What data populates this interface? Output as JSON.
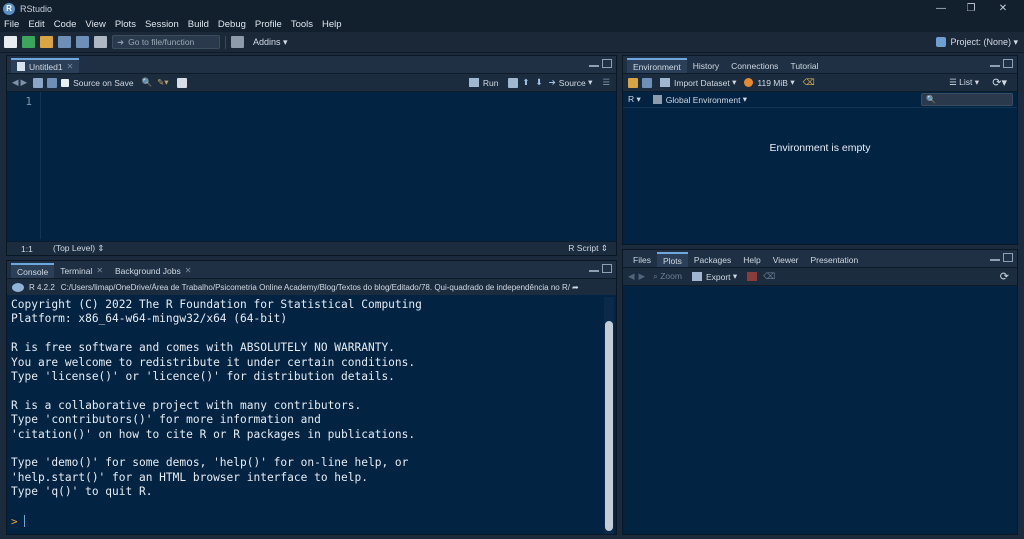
{
  "window": {
    "title": "RStudio"
  },
  "menu": [
    "File",
    "Edit",
    "Code",
    "View",
    "Plots",
    "Session",
    "Build",
    "Debug",
    "Profile",
    "Tools",
    "Help"
  ],
  "toolbar": {
    "goto_placeholder": "Go to file/function",
    "addins_label": "Addins",
    "project_label": "Project: (None)"
  },
  "source": {
    "tab_label": "Untitled1",
    "source_on_save": "Source on Save",
    "run_label": "Run",
    "source_label": "Source",
    "line_number": "1",
    "status_position": "1:1",
    "status_scope": "(Top Level)",
    "status_type": "R Script"
  },
  "environment": {
    "tabs": [
      "Environment",
      "History",
      "Connections",
      "Tutorial"
    ],
    "import_label": "Import Dataset",
    "memory_label": "119 MiB",
    "list_label": "List",
    "lang_label": "R",
    "scope_label": "Global Environment",
    "empty_message": "Environment is empty"
  },
  "console": {
    "tabs": [
      "Console",
      "Terminal",
      "Background Jobs"
    ],
    "r_version": "R 4.2.2",
    "path": "C:/Users/limap/OneDrive/Área de Trabalho/Psicometria Online Academy/Blog/Textos do blog/Editado/78. Qui-quadrado de independência no R/",
    "output": "Copyright (C) 2022 The R Foundation for Statistical Computing\nPlatform: x86_64-w64-mingw32/x64 (64-bit)\n\nR is free software and comes with ABSOLUTELY NO WARRANTY.\nYou are welcome to redistribute it under certain conditions.\nType 'license()' or 'licence()' for distribution details.\n\nR is a collaborative project with many contributors.\nType 'contributors()' for more information and\n'citation()' on how to cite R or R packages in publications.\n\nType 'demo()' for some demos, 'help()' for on-line help, or\n'help.start()' for an HTML browser interface to help.\nType 'q()' to quit R.",
    "prompt": ">"
  },
  "files": {
    "tabs": [
      "Files",
      "Plots",
      "Packages",
      "Help",
      "Viewer",
      "Presentation"
    ],
    "zoom_label": "Zoom",
    "export_label": "Export"
  }
}
